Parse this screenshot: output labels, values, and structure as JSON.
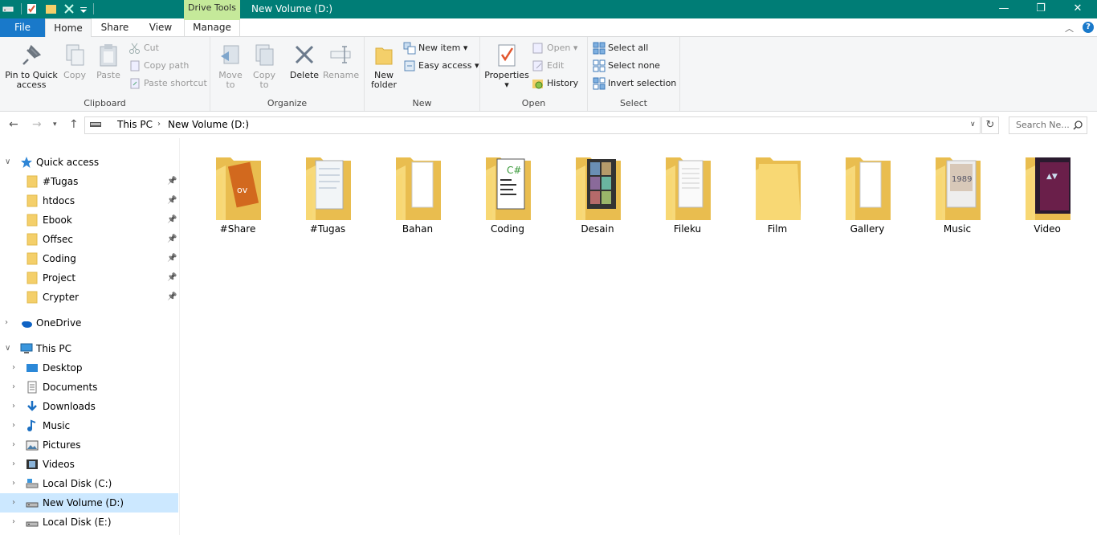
{
  "title_bar": {
    "context_tab": "Drive Tools",
    "window_title": "New Volume (D:)",
    "minimize": "—",
    "maximize": "❐",
    "close": "✕"
  },
  "tabs": {
    "file": "File",
    "home": "Home",
    "share": "Share",
    "view": "View",
    "manage": "Manage"
  },
  "ribbon": {
    "clipboard": {
      "label": "Clipboard",
      "pin": "Pin to Quick access",
      "pin_line1": "Pin to Quick",
      "pin_line2": "access",
      "copy": "Copy",
      "paste": "Paste",
      "cut": "Cut",
      "copy_path": "Copy path",
      "paste_shortcut": "Paste shortcut"
    },
    "organize": {
      "label": "Organize",
      "move_to": "Move",
      "move_to_2": "to",
      "copy_to": "Copy",
      "copy_to_2": "to",
      "delete": "Delete",
      "rename": "Rename"
    },
    "new": {
      "label": "New",
      "new_folder_1": "New",
      "new_folder_2": "folder",
      "new_item": "New item",
      "easy_access": "Easy access"
    },
    "open": {
      "label": "Open",
      "properties": "Properties",
      "open": "Open",
      "edit": "Edit",
      "history": "History"
    },
    "select": {
      "label": "Select",
      "select_all": "Select all",
      "select_none": "Select none",
      "invert": "Invert selection"
    }
  },
  "address": {
    "this_pc": "This PC",
    "volume": "New Volume (D:)",
    "search_placeholder": "Search Ne..."
  },
  "nav": {
    "quick_access": "Quick access",
    "quick_items": [
      "#Tugas",
      "htdocs",
      "Ebook",
      "Offsec",
      "Coding",
      "Project",
      "Crypter"
    ],
    "onedrive": "OneDrive",
    "this_pc": "This PC",
    "pc_items": [
      "Desktop",
      "Documents",
      "Downloads",
      "Music",
      "Pictures",
      "Videos",
      "Local Disk (C:)",
      "New Volume (D:)",
      "Local Disk (E:)"
    ]
  },
  "files": [
    "#Share",
    "#Tugas",
    "Bahan",
    "Coding",
    "Desain",
    "Fileku",
    "Film",
    "Gallery",
    "Music",
    "Video"
  ],
  "colors": {
    "titlebar": "#007d76",
    "file_tab": "#1979ca",
    "context_tab": "#c5e99a",
    "selection": "#cce8ff",
    "folder": "#f4cf6a"
  }
}
